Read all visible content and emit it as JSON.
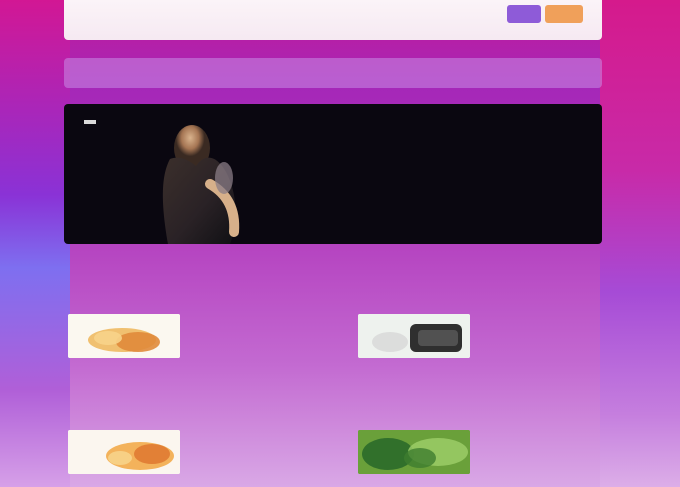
{
  "topbar": {
    "logo_text": "",
    "purple_button_label": "",
    "orange_button_label": ""
  },
  "nav": {
    "items": [
      {
        "label": ""
      },
      {
        "label": ""
      },
      {
        "label": ""
      },
      {
        "label": ""
      },
      {
        "label": ""
      },
      {
        "label": ""
      },
      {
        "label": ""
      }
    ]
  },
  "hero": {
    "tag": "",
    "title": "",
    "subtitle": "",
    "price": "",
    "colors": {
      "background": "#0a0710"
    }
  },
  "sections": {
    "left_heading": "",
    "right_heading": ""
  },
  "cards": [
    {
      "title": "",
      "desc": "",
      "thumb_colors": [
        "#fbf8f0",
        "#f0c070",
        "#e08a3a"
      ]
    },
    {
      "title": "",
      "desc": "",
      "thumb_colors": [
        "#eef2ee",
        "#2f2f2f",
        "#555555"
      ]
    },
    {
      "title": "",
      "desc": "",
      "thumb_colors": [
        "#fbf6ef",
        "#f3b25b",
        "#e07a32"
      ]
    },
    {
      "title": "",
      "desc": "",
      "thumb_colors": [
        "#6aa03a",
        "#2b6a2a",
        "#9fd06a"
      ]
    }
  ],
  "colors": {
    "page_magenta": "#c21a9a",
    "page_purple": "#a527b8",
    "topbar": "#fbf4f8",
    "accent_purple": "#8e5bd8",
    "accent_orange": "#f0a05a"
  }
}
